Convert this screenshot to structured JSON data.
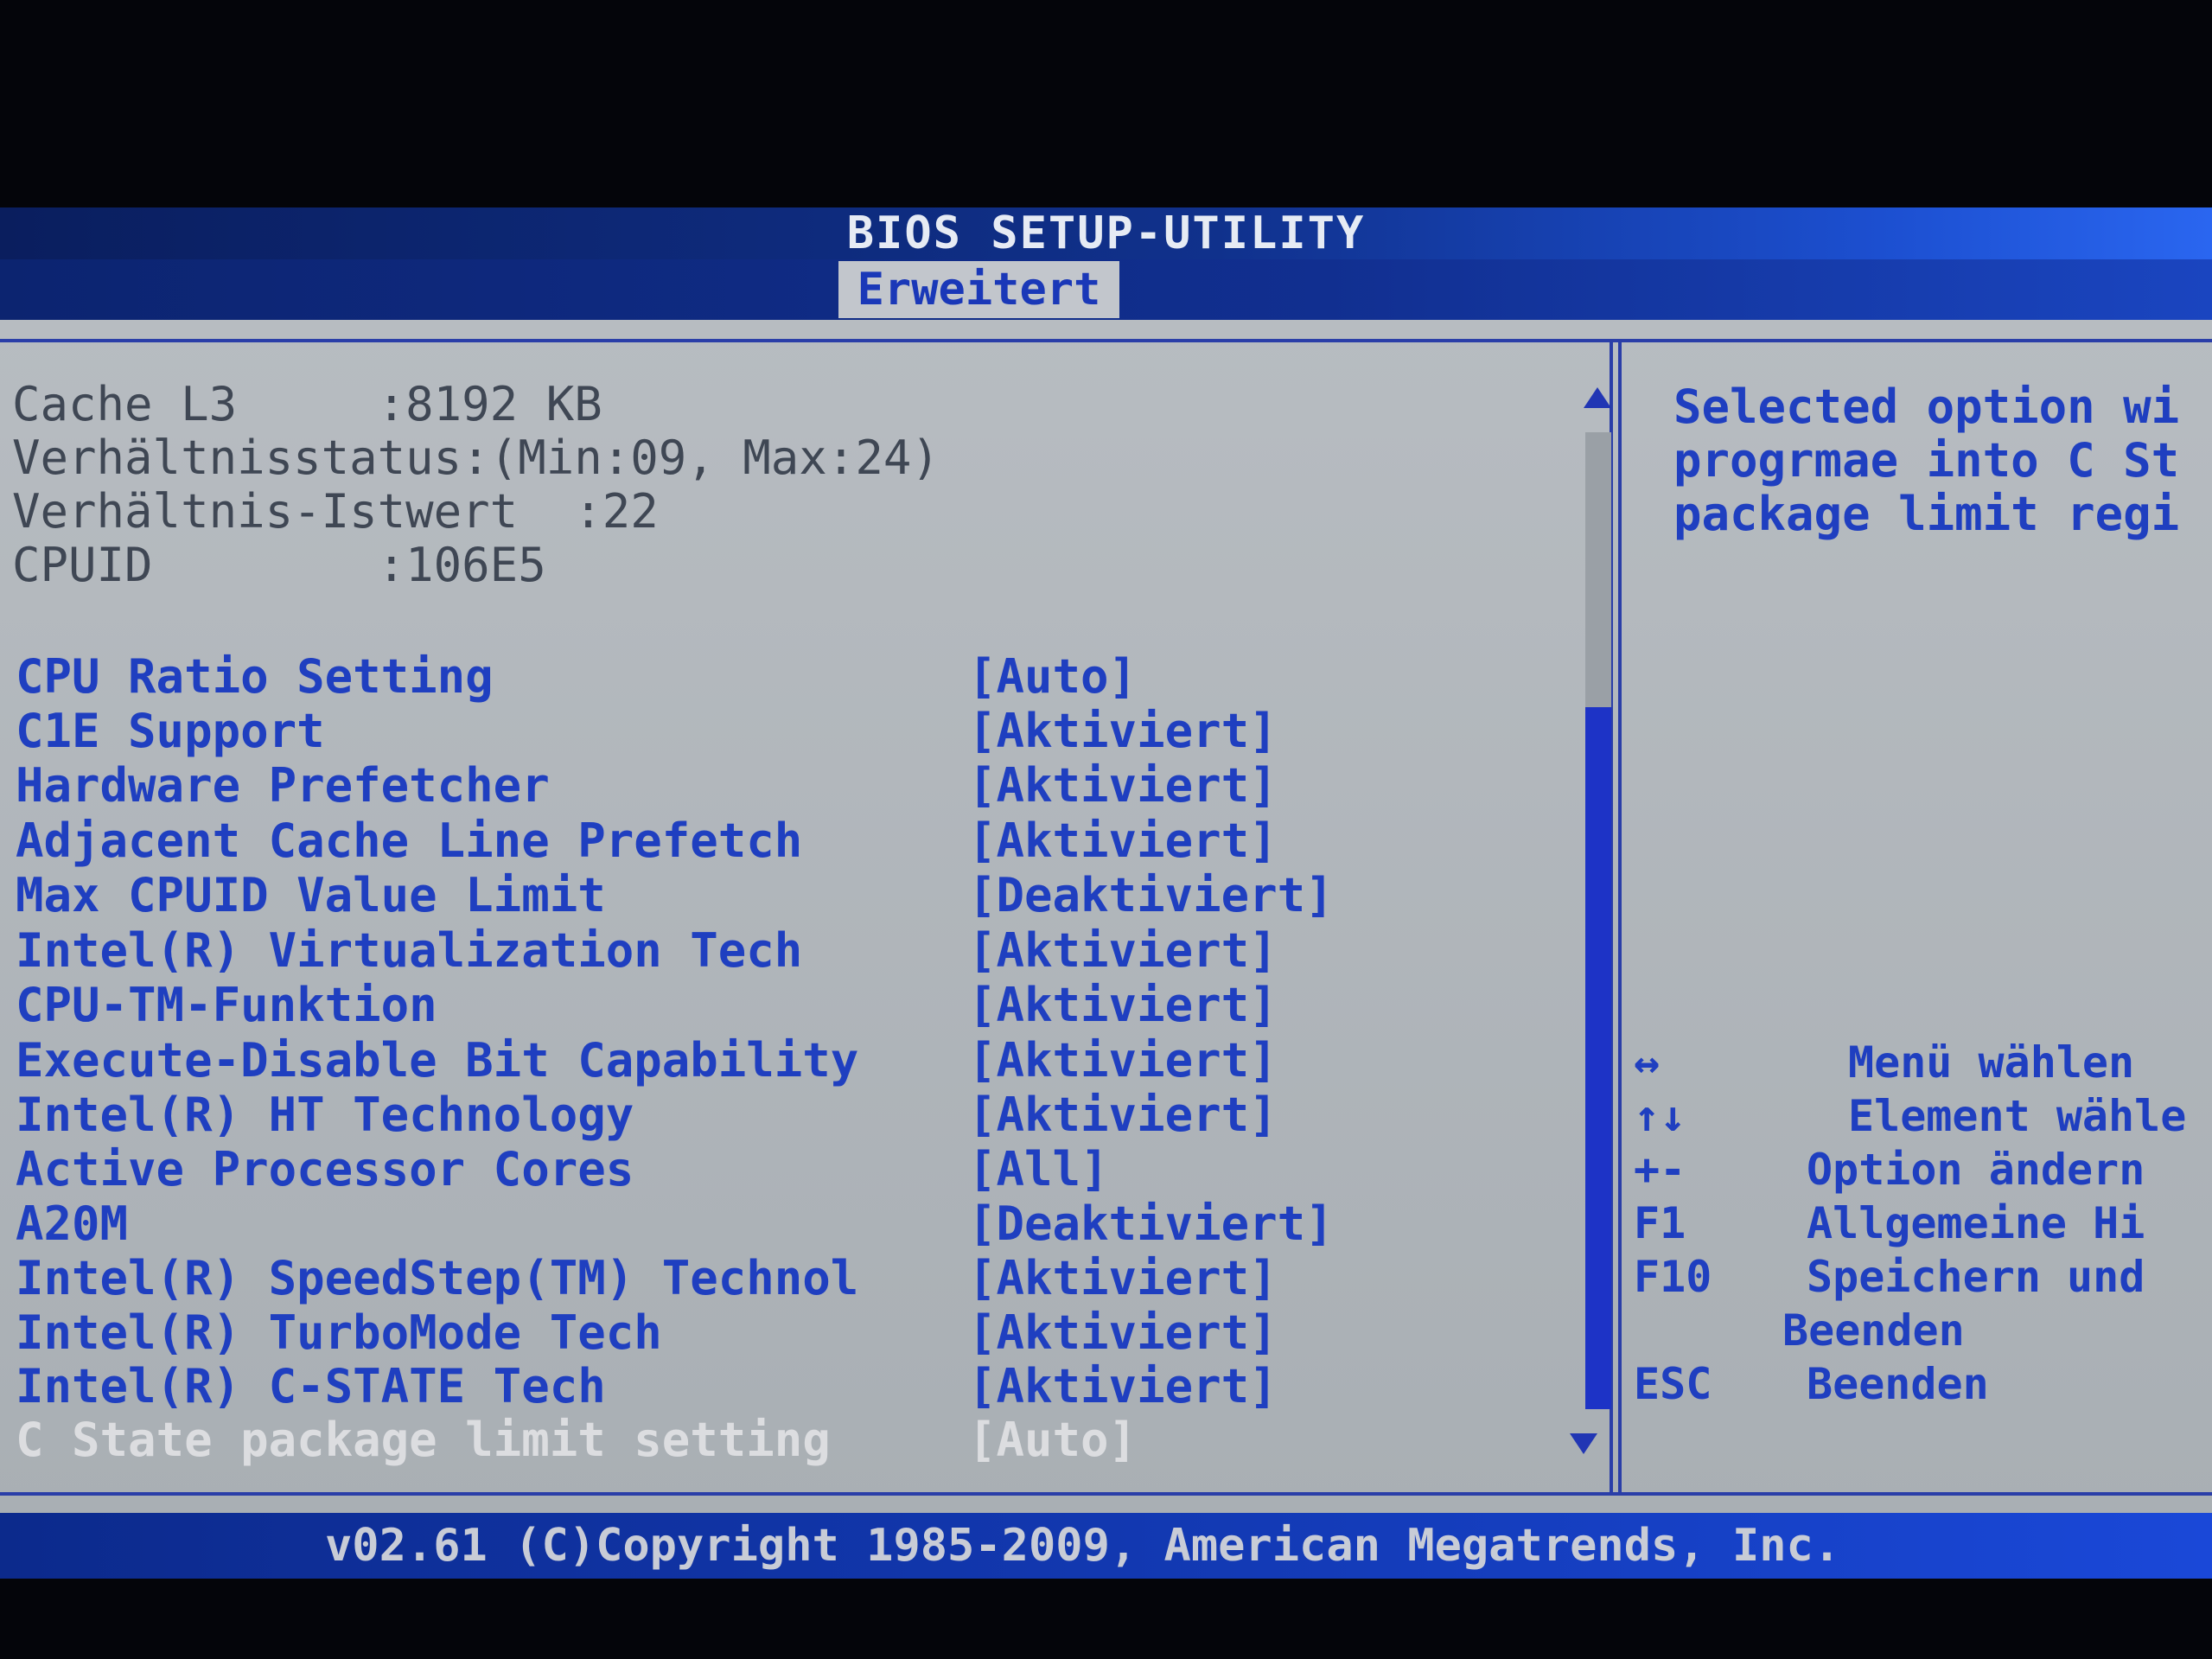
{
  "window": {
    "title": "BIOS SETUP-UTILITY",
    "active_tab": "Erweitert"
  },
  "info": [
    {
      "text": "Cache L3     :8192 KB"
    },
    {
      "text": "Verhältnisstatus:(Min:09, Max:24)"
    },
    {
      "text": "Verhältnis-Istwert  :22"
    },
    {
      "text": "CPUID        :106E5"
    }
  ],
  "settings": [
    {
      "label": "CPU Ratio Setting",
      "value": "[Auto]"
    },
    {
      "label": "C1E Support",
      "value": "[Aktiviert]"
    },
    {
      "label": "Hardware Prefetcher",
      "value": "[Aktiviert]"
    },
    {
      "label": "Adjacent Cache Line Prefetch",
      "value": "[Aktiviert]"
    },
    {
      "label": "Max CPUID Value Limit",
      "value": "[Deaktiviert]"
    },
    {
      "label": "Intel(R) Virtualization Tech",
      "value": "[Aktiviert]"
    },
    {
      "label": "CPU-TM-Funktion",
      "value": "[Aktiviert]"
    },
    {
      "label": "Execute-Disable Bit Capability",
      "value": "[Aktiviert]"
    },
    {
      "label": "Intel(R) HT Technology",
      "value": "[Aktiviert]"
    },
    {
      "label": "Active Processor Cores",
      "value": "[All]"
    },
    {
      "label": "A20M",
      "value": "[Deaktiviert]"
    },
    {
      "label": "Intel(R) SpeedStep(TM) Technol",
      "value": "[Aktiviert]"
    },
    {
      "label": "Intel(R) TurboMode Tech",
      "value": "[Aktiviert]"
    },
    {
      "label": "Intel(R) C-STATE Tech",
      "value": "[Aktiviert]"
    },
    {
      "label": "C State package limit setting",
      "value": "[Auto]",
      "selected": true
    }
  ],
  "help": {
    "lines": [
      "Selected option wi",
      "progrmae into C St",
      "package limit regi"
    ]
  },
  "keys": [
    {
      "key": "↔",
      "desc": "Menü wählen"
    },
    {
      "key": "↑↓",
      "desc": "Element wähle"
    },
    {
      "key": "+-",
      "desc": "Option ändern"
    },
    {
      "key": "F1",
      "desc": "Allgemeine Hi"
    },
    {
      "key": "F10",
      "desc": "Speichern und"
    },
    {
      "key": "",
      "desc": "Beenden"
    },
    {
      "key": "ESC",
      "desc": "Beenden"
    }
  ],
  "footer": {
    "text": "v02.61 (C)Copyright 1985-2009, American Megatrends, Inc."
  },
  "colors": {
    "bar_blue": "#112f90",
    "panel_grey": "#b1b6bb",
    "setting_text_blue": "#1f3fc0",
    "selected_text": "#dcdde0",
    "info_text": "#3f4754"
  }
}
